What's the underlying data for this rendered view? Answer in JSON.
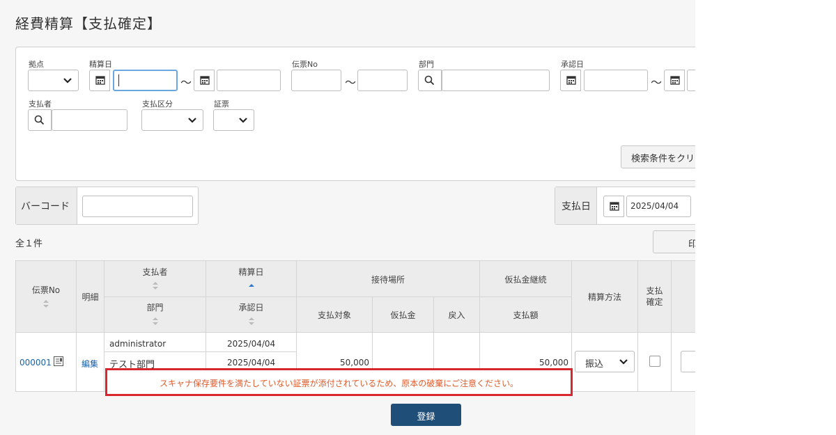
{
  "page": {
    "title": "経費精算【支払確定】"
  },
  "search": {
    "base_label": "拠点",
    "settle_date_label": "精算日",
    "tilde": "～",
    "slip_no_label": "伝票No",
    "department_label": "部門",
    "approval_date_label": "承認日",
    "payer_label": "支払者",
    "payment_type_label": "支払区分",
    "voucher_label": "証票",
    "clear_button": "検索条件をクリア"
  },
  "barcode": {
    "label": "バーコード",
    "value": ""
  },
  "payment_date": {
    "label": "支払日",
    "value": "2025/04/04"
  },
  "results": {
    "count_text": "全１件",
    "print_button": "印刷"
  },
  "table": {
    "headers": {
      "slip_no": "伝票No",
      "detail": "明細",
      "payer": "支払者",
      "department": "部門",
      "settle_date": "精算日",
      "approval_date": "承認日",
      "venue": "接待場所",
      "target": "支払対象",
      "advance": "仮払金",
      "refund": "戻入",
      "advance_continue": "仮払金継続",
      "amount": "支払額",
      "method": "精算方法",
      "confirm_line1": "支払",
      "confirm_line2": "確定"
    },
    "rows": [
      {
        "slip_no": "000001",
        "detail": "編集",
        "payer": "administrator",
        "department": "テスト部門",
        "settle_date": "2025/04/04",
        "approval_date": "2025/04/04",
        "target": "50,000",
        "amount": "50,000",
        "method": "振込"
      }
    ]
  },
  "warning": {
    "text": "スキャナ保存要件を満たしていない証票が添付されているため、原本の破棄にご注意ください。"
  },
  "register_button": "登録",
  "colors": {
    "link": "#1a62a8",
    "warning_border": "#d9262e",
    "warning_text": "#e05a2a",
    "primary_button": "#1f4e79"
  }
}
